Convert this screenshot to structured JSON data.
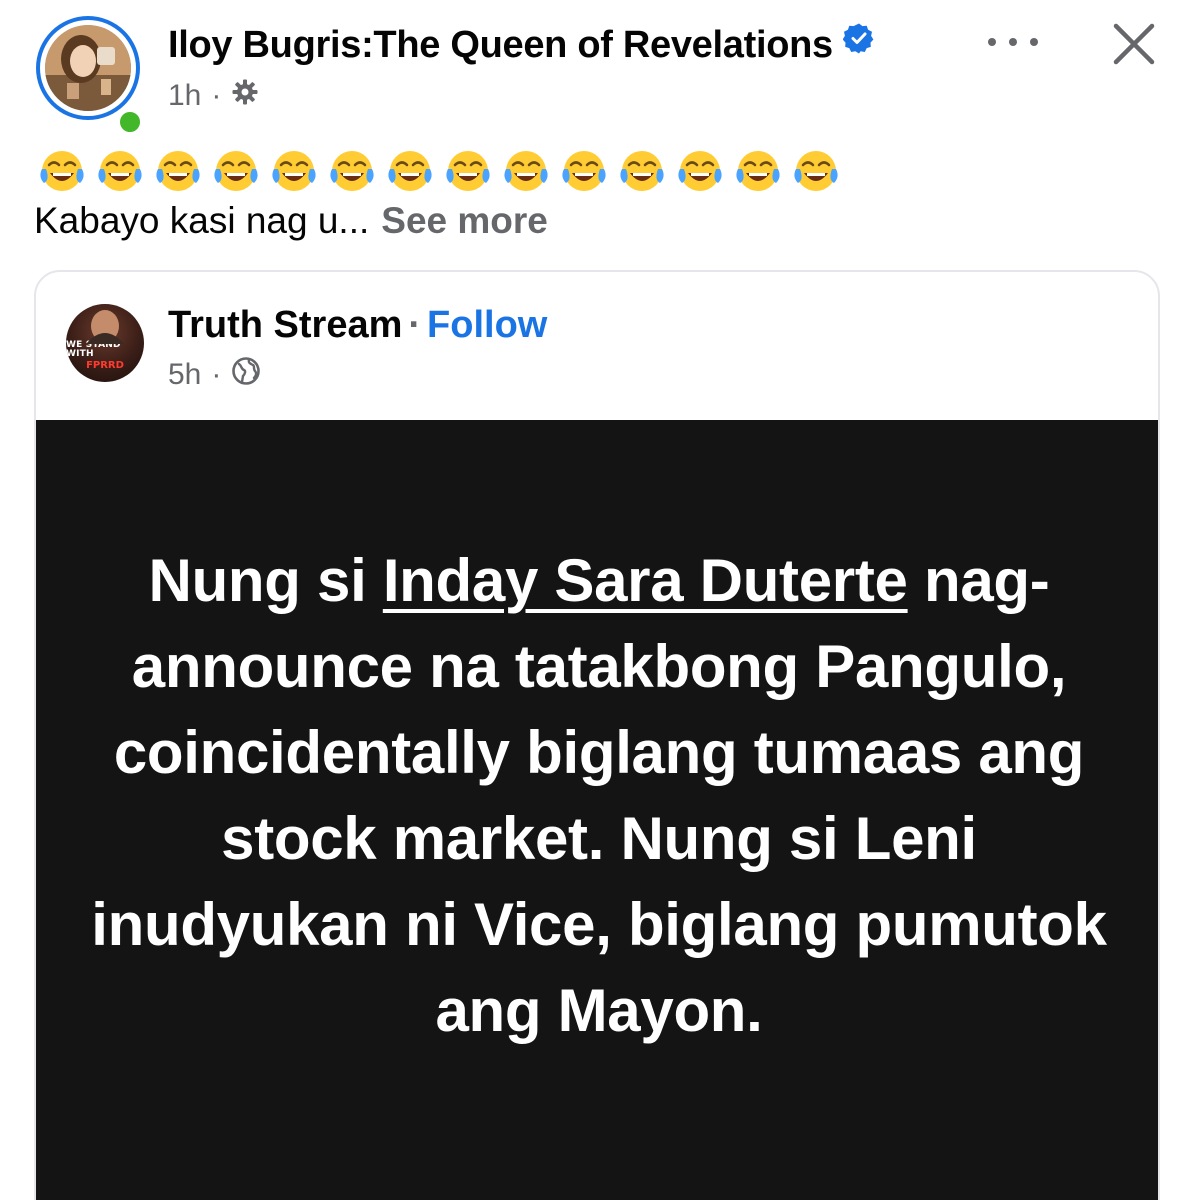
{
  "post": {
    "author": "Iloy Bugris:The Queen of Revelations",
    "time": "1h",
    "separator": "·",
    "emoji_count": 14,
    "caption": "Kabayo kasi nag u...",
    "see_more": "See more"
  },
  "shared": {
    "page_name": "Truth Stream",
    "separator": "·",
    "follow": "Follow",
    "time": "5h",
    "meta_separator": "·",
    "avatar_text_line1": "WE STAND WITH",
    "avatar_text_line2": "FPRRD",
    "image_text": {
      "line1_pre": "Nung si ",
      "line1_highlight": "Inday Sara Duterte",
      "rest": "nag-announce na tatakbong Pangulo, coincidentally biglang tumaas ang stock market. Nung si Leni inudyukan ni Vice, biglang pumutok ang Mayon."
    }
  },
  "colors": {
    "accent": "#1b74e4",
    "online": "#42b72a",
    "secondary_text": "#65676b",
    "image_bg": "#141414"
  },
  "icons": {
    "verified": "verified-badge-icon",
    "audience_friends": "gear-icon",
    "audience_public": "globe-icon",
    "more": "more-icon",
    "close": "close-icon",
    "emoji": "face-with-tears-of-joy-icon"
  }
}
